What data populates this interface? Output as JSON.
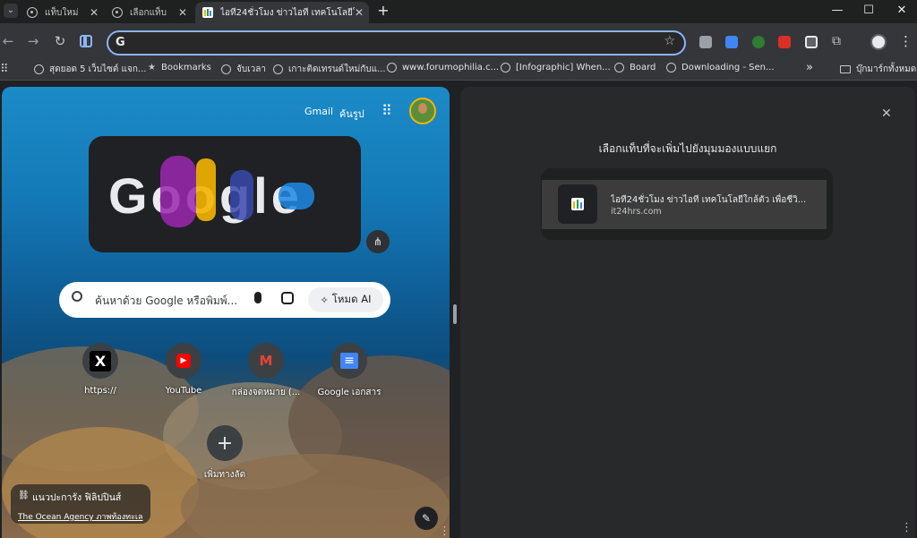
{
  "tabs": [
    {
      "label": "แท็บใหม่",
      "active": false
    },
    {
      "label": "เลือกแท็บ",
      "active": false
    },
    {
      "label": "ไอที24ชั่วโมง ข่าวไอที เทคโนโลยีใกล้...",
      "active": true
    }
  ],
  "window": {
    "new_tab": "+",
    "minimize": "—",
    "maximize": "☐",
    "close": "✕"
  },
  "toolbar": {
    "back": "←",
    "forward": "→",
    "reload": "↻",
    "omnibox_value": "",
    "omnibox_prefix": "G",
    "star": "☆",
    "menu": "⋮"
  },
  "bookmarks": [
    {
      "label": "สุดยอด 5 เว็บไซต์ แจก..."
    },
    {
      "label": "Bookmarks"
    },
    {
      "label": "จับเวลา"
    },
    {
      "label": "เกาะติดเทรนด์ใหม่กับแ..."
    },
    {
      "label": "www.forumophilia.c..."
    },
    {
      "label": "[Infographic] When..."
    },
    {
      "label": "Board"
    },
    {
      "label": "Downloading - Sen..."
    }
  ],
  "bookmarks_overflow": "»",
  "bookmarks_all": "บุ๊กมาร์กทั้งหมด",
  "ntp": {
    "gmail": "Gmail",
    "images": "ค้นรูป",
    "apps_icon": "⠿",
    "doodle_text": "Google",
    "search_placeholder": "ค้นหาด้วย Google หรือพิมพ์...",
    "ai_mode": "โหมด AI",
    "shortcuts": [
      {
        "label": "https://",
        "glyph": "X",
        "color": "#000000"
      },
      {
        "label": "YouTube",
        "glyph": "▶",
        "color": "#ff0000"
      },
      {
        "label": "กล่องจดหมาย (...",
        "glyph": "M",
        "color": "#ea4335"
      },
      {
        "label": "Google เอกสาร",
        "glyph": "≡",
        "color": "#4285f4"
      }
    ],
    "add_shortcut_label": "เพิ่มทางลัด",
    "add_glyph": "+",
    "attribution_title": "แนวปะการัง ฟิลิปปินส์",
    "attribution_sub": "The Ocean Agency ภาพท้องทะเล"
  },
  "side_panel": {
    "close": "✕",
    "heading": "เลือกแท็บที่จะเพิ่มไปยังมุมมองแบบแยก",
    "item_title": "ไอที24ชั่วโมง ข่าวไอที เทคโนโลยีใกล้ตัว เพื่อชีวิ...",
    "item_url": "it24hrs.com"
  }
}
